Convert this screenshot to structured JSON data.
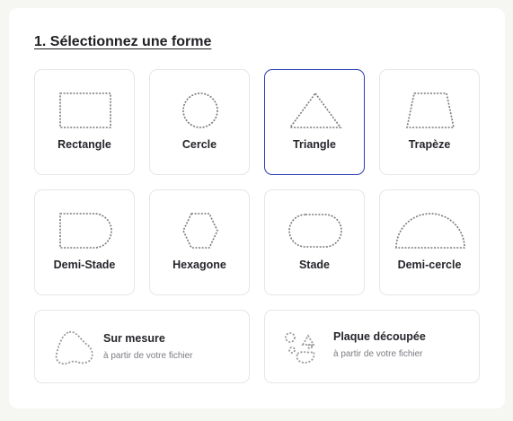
{
  "section": {
    "title": "1. Sélectionnez une forme"
  },
  "shapes": [
    {
      "label": "Rectangle",
      "icon": "rectangle-icon",
      "selected": false
    },
    {
      "label": "Cercle",
      "icon": "circle-icon",
      "selected": false
    },
    {
      "label": "Triangle",
      "icon": "triangle-icon",
      "selected": true
    },
    {
      "label": "Trapèze",
      "icon": "trapezoid-icon",
      "selected": false
    },
    {
      "label": "Demi-Stade",
      "icon": "half-stadium-icon",
      "selected": false
    },
    {
      "label": "Hexagone",
      "icon": "hexagon-icon",
      "selected": false
    },
    {
      "label": "Stade",
      "icon": "stadium-icon",
      "selected": false
    },
    {
      "label": "Demi-cercle",
      "icon": "half-circle-icon",
      "selected": false
    }
  ],
  "custom": [
    {
      "label": "Sur mesure",
      "subtitle": "à partir de votre fichier",
      "icon": "freeform-shape-icon"
    },
    {
      "label": "Plaque découpée",
      "subtitle": "à partir de votre fichier",
      "icon": "cutout-plate-icon"
    }
  ],
  "colors": {
    "selected_border": "#2a3db3",
    "card_border": "#e6e6e6",
    "background": "#f6f6f3"
  }
}
